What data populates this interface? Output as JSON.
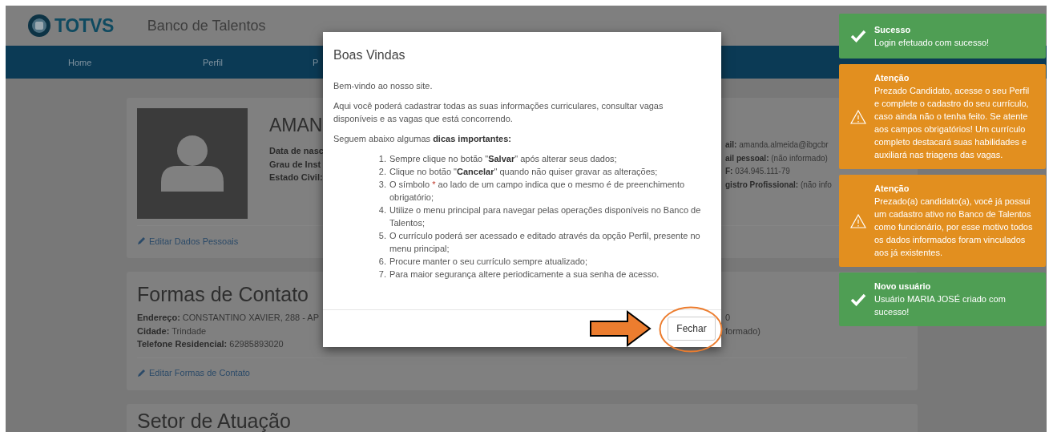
{
  "header": {
    "logo": "TOTVS",
    "title": "Banco de Talentos"
  },
  "nav": [
    {
      "label": "Home"
    },
    {
      "label": "Perfil"
    },
    {
      "label": "P"
    }
  ],
  "profile": {
    "name": "AMAN",
    "left_fields": [
      {
        "label": "Data de nasc"
      },
      {
        "label": "Grau de Inst"
      },
      {
        "label": "Estado Civil:"
      }
    ],
    "right_fields": [
      {
        "label": "ail:",
        "value": "amanda.almeida@ibgcbr"
      },
      {
        "label": "ail pessoal:",
        "value": "(não informado)"
      },
      {
        "label": "F:",
        "value": "034.945.111-79"
      },
      {
        "label": "gistro Profissional:",
        "value": "(não info"
      }
    ],
    "edit_link": "Editar Dados Pessoais"
  },
  "contact": {
    "title": "Formas de Contato",
    "left_fields": [
      {
        "label": "Endereço:",
        "value": "CONSTANTINO XAVIER, 288 - AP"
      },
      {
        "label": "Cidade:",
        "value": "Trindade"
      },
      {
        "label": "Telefone Residencial:",
        "value": "62985893020"
      }
    ],
    "right_fields": [
      {
        "value": "0"
      },
      {
        "value": "formado)"
      }
    ],
    "edit_link": "Editar Formas de Contato"
  },
  "sector": {
    "title": "Setor de Atuação"
  },
  "modal": {
    "title": "Boas Vindas",
    "paragraphs": [
      "Bem-vindo ao nosso site.",
      "Aqui você poderá cadastrar todas as suas informações curriculares, consultar vagas disponíveis e as vagas que está concorrendo.",
      "Seguem abaixo algumas **dicas importantes:**"
    ],
    "tips": [
      {
        "number": "1.",
        "text": "Sempre clique no botão \"**Salvar**\" após alterar seus dados;"
      },
      {
        "number": "2.",
        "text": "Clique no botão \"**Cancelar**\" quando não quiser gravar as alterações;"
      },
      {
        "number": "3.",
        "text": "O símbolo ",
        "mark": "*",
        "rest": " ao lado de um campo indica que o mesmo é de preenchimento obrigatório;"
      },
      {
        "number": "4.",
        "text": "Utilize o menu principal para navegar pelas operações disponíveis no Banco de Talentos;"
      },
      {
        "number": "5.",
        "text": "O currículo poderá ser acessado e editado através da opção Perfil, presente no menu principal;"
      },
      {
        "number": "6.",
        "text": "Procure manter o seu currículo sempre atualizado;"
      },
      {
        "number": "7.",
        "text": "Para maior segurança altere periodicamente a sua senha de acesso."
      }
    ],
    "close_button": "Fechar"
  },
  "toasts": [
    {
      "kind": "success",
      "title": "Sucesso",
      "message": "Login efetuado com sucesso!"
    },
    {
      "kind": "warning",
      "title": "Atenção",
      "message": "Prezado Candidato, acesse o seu Perfil e complete o cadastro do seu currículo, caso ainda não o tenha feito. Se atente aos campos obrigatórios! Um currículo completo destacará suas habilidades e auxiliará nas triagens das vagas."
    },
    {
      "kind": "warning",
      "title": "Atenção",
      "message": "Prezado(a) candidato(a), você já possui um cadastro ativo no Banco de Talentos como funcionário, por esse motivo todos os dados informados foram vinculados aos já existentes."
    },
    {
      "kind": "success",
      "title": "Novo usuário",
      "message": "Usuário MARIA JOSÉ criado com sucesso!"
    }
  ]
}
